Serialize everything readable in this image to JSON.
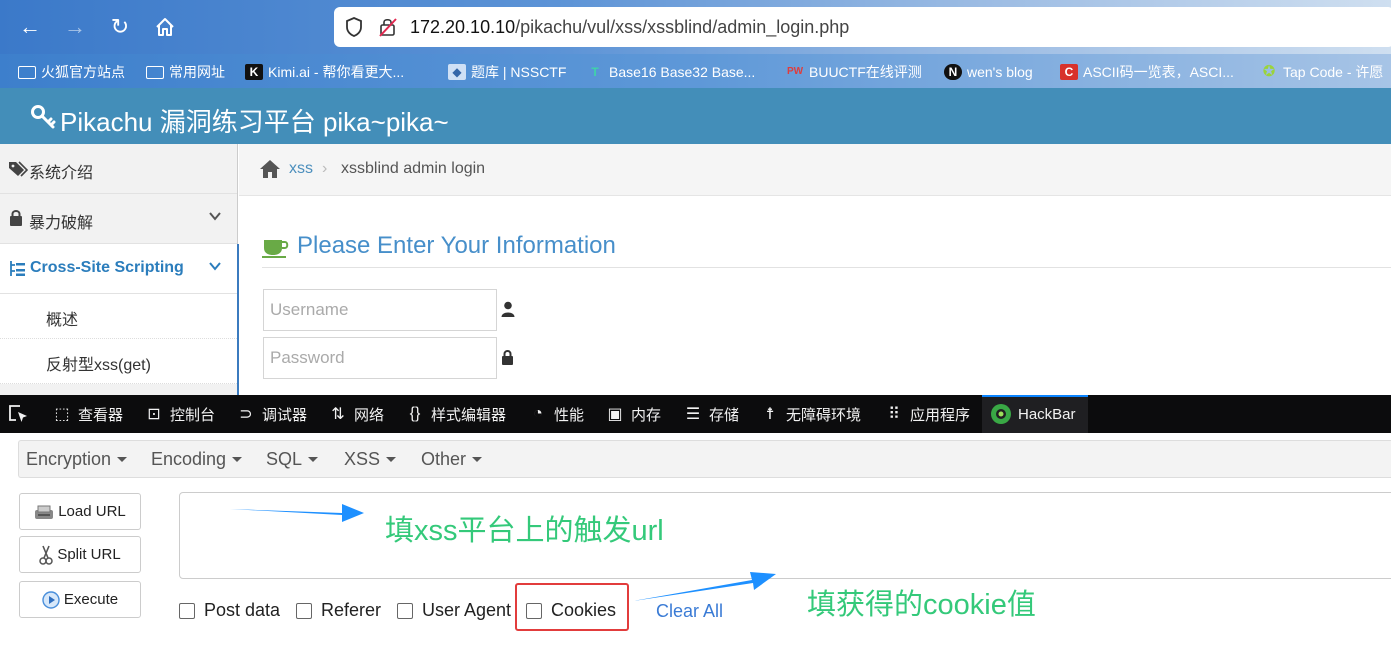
{
  "browser": {
    "url_host": "172.20.10.10",
    "url_path": "/pikachu/vul/xss/xssblind/admin_login.php",
    "bookmarks": [
      {
        "label": "火狐官方站点",
        "icon": "folder-icon"
      },
      {
        "label": "常用网址",
        "icon": "folder-icon"
      },
      {
        "label": "Kimi.ai - 帮你看更大...",
        "icon": "kimi-icon"
      },
      {
        "label": "题库 | NSSCTF",
        "icon": "nssctf-icon"
      },
      {
        "label": "Base16 Base32 Base...",
        "icon": "base-icon"
      },
      {
        "label": "BUUCTF在线评测",
        "icon": "buuctf-icon"
      },
      {
        "label": "wen's blog",
        "icon": "n-icon"
      },
      {
        "label": "ASCII码一览表，ASCI...",
        "icon": "c-icon"
      },
      {
        "label": "Tap Code - 许愿",
        "icon": "star-icon"
      }
    ]
  },
  "site": {
    "title": "Pikachu 漏洞练习平台 pika~pika~"
  },
  "sidebar": {
    "items": [
      {
        "label": "系统介绍",
        "icon": "tags-icon"
      },
      {
        "label": "暴力破解",
        "icon": "lock-icon"
      },
      {
        "label": "Cross-Site Scripting",
        "icon": "list-icon"
      }
    ],
    "subitems": [
      "概述",
      "反射型xss(get)"
    ]
  },
  "breadcrumb": {
    "section": "xss",
    "sep": "›",
    "current": "xssblind admin login"
  },
  "form": {
    "title": "Please Enter Your Information",
    "username_placeholder": "Username",
    "password_placeholder": "Password"
  },
  "devtools": {
    "tabs": [
      "查看器",
      "控制台",
      "调试器",
      "网络",
      "样式编辑器",
      "性能",
      "内存",
      "存储",
      "无障碍环境",
      "应用程序",
      "HackBar"
    ]
  },
  "hackbar": {
    "menus": [
      "Encryption",
      "Encoding",
      "SQL",
      "XSS",
      "Other"
    ],
    "buttons": [
      "Load URL",
      "Split URL",
      "Execute"
    ],
    "options": [
      "Post data",
      "Referer",
      "User Agent",
      "Cookies"
    ],
    "clear_all": "Clear All"
  },
  "annotations": {
    "url_note": "填xss平台上的触发url",
    "cookie_note": "填获得的cookie值",
    "color": "#34c97a",
    "arrow_color": "#1e90ff"
  },
  "colors": {
    "header": "#438eb9",
    "highlight_box": "#e23c3c",
    "link": "#3a7bd5"
  }
}
